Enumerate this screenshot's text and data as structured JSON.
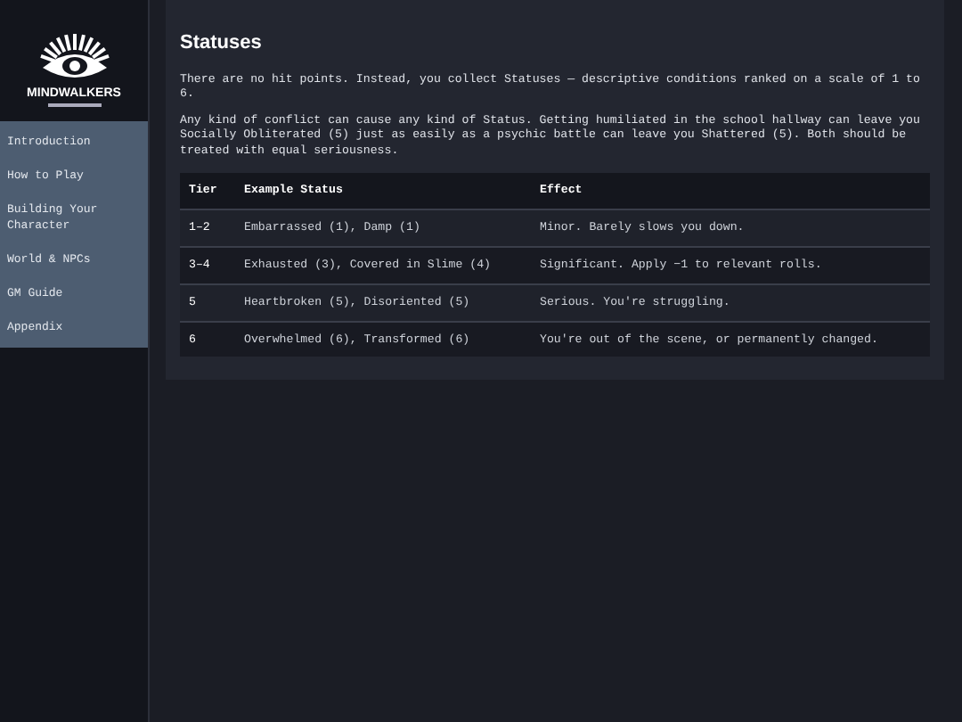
{
  "logo": {
    "title": "MINDWALKERS"
  },
  "sidebar": {
    "items": [
      {
        "label": "Introduction",
        "selected": false
      },
      {
        "label": "How to Play",
        "selected": false
      },
      {
        "label": "Building Your Character",
        "selected": false
      },
      {
        "label": "World & NPCs",
        "selected": false
      },
      {
        "label": "GM Guide",
        "selected": false
      },
      {
        "label": "Appendix",
        "selected": false
      }
    ]
  },
  "content": {
    "heading": "Statuses",
    "paragraphs": [
      "There are no hit points. Instead, you collect Statuses — descriptive conditions ranked on a scale of 1 to 6.",
      "Any kind of conflict can cause any kind of Status. Getting humiliated in the school hallway can leave you Socially Obliterated (5) just as easily as a psychic battle can leave you Shattered (5). Both should be treated with equal seriousness."
    ],
    "table": {
      "columns": [
        "Tier",
        "Example Status",
        "Effect"
      ],
      "rows": [
        [
          "1–2",
          "Embarrassed (1), Damp (1)",
          "Minor. Barely slows you down."
        ],
        [
          "3–4",
          "Exhausted (3), Covered in Slime (4)",
          "Significant. Apply −1 to relevant rolls."
        ],
        [
          "5",
          "Heartbroken (5), Disoriented (5)",
          "Serious. You're struggling."
        ],
        [
          "6",
          "Overwhelmed (6), Transformed (6)",
          "You're out of the scene, or permanently changed."
        ]
      ]
    }
  }
}
